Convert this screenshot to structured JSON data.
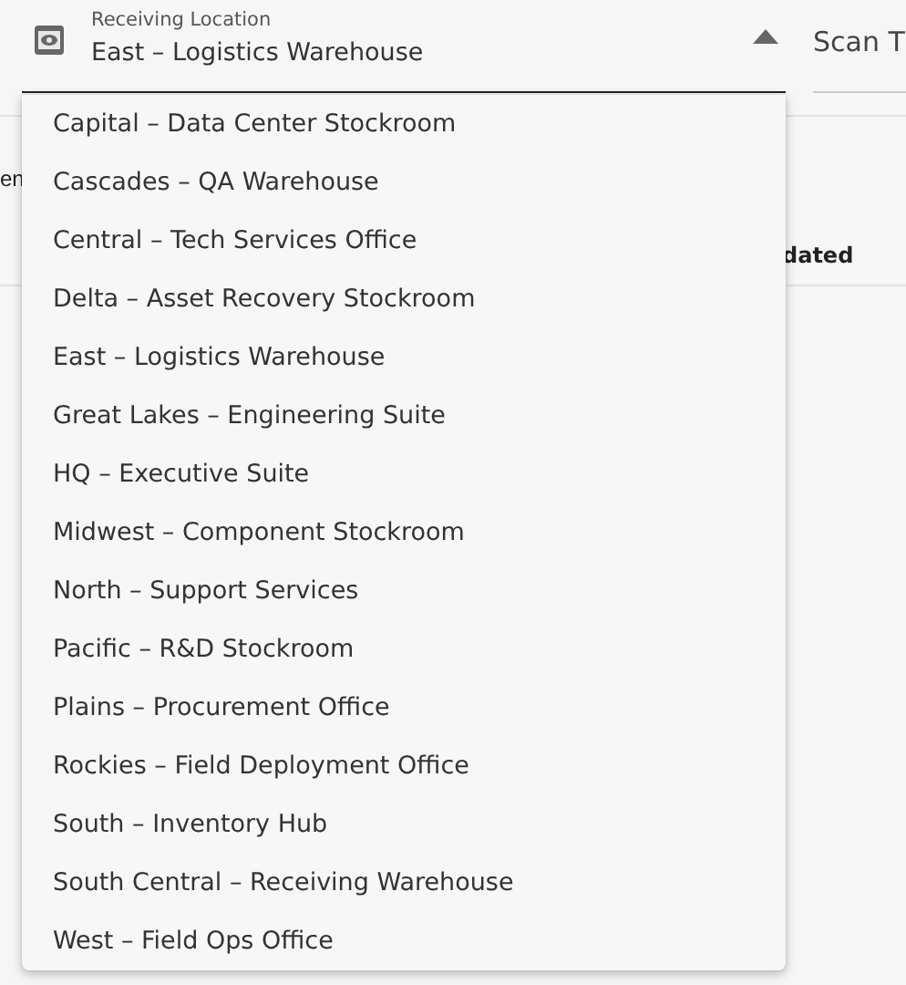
{
  "field": {
    "label": "Receiving Location",
    "value": "East – Logistics Warehouse",
    "expanded": true
  },
  "next_field": {
    "label": "Scan T"
  },
  "background": {
    "heading": "en",
    "column_header": "dated"
  },
  "menu": {
    "options": [
      "Capital – Data Center Stockroom",
      "Cascades – QA Warehouse",
      "Central – Tech Services Office",
      "Delta – Asset Recovery Stockroom",
      "East – Logistics Warehouse",
      "Great Lakes – Engineering Suite",
      "HQ – Executive Suite",
      "Midwest – Component Stockroom",
      "North – Support Services",
      "Pacific – R&D Stockroom",
      "Plains – Procurement Office",
      "Rockies – Field Deployment Office",
      "South – Inventory Hub",
      "South Central – Receiving Warehouse",
      "West – Field Ops Office"
    ]
  }
}
